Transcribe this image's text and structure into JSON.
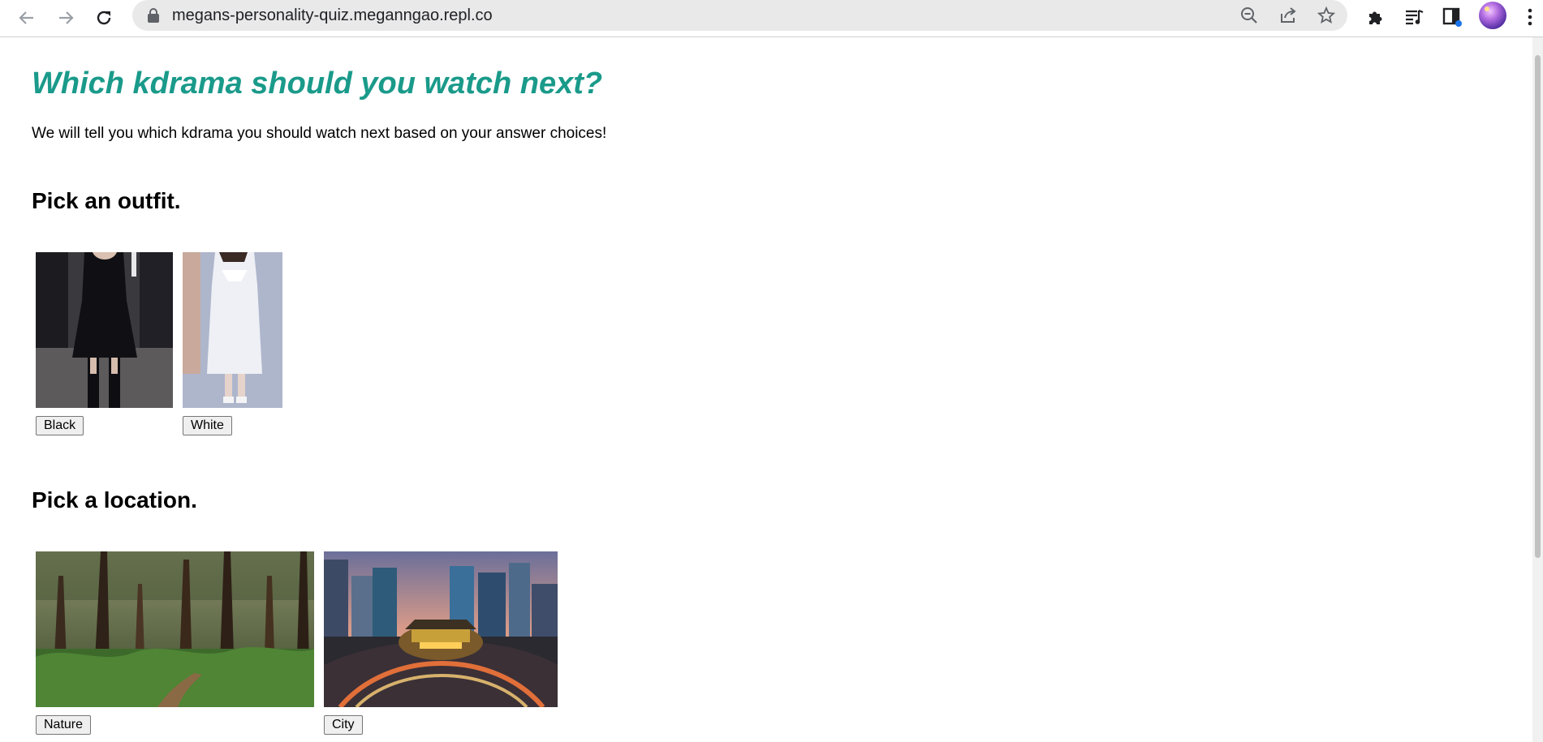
{
  "browser": {
    "url": "megans-personality-quiz.meganngao.repl.co",
    "icons": [
      "back-arrow-icon",
      "forward-arrow-icon",
      "reload-icon",
      "lock-icon",
      "zoom-out-icon",
      "share-icon",
      "star-icon",
      "extensions-puzzle-icon",
      "reading-list-icon",
      "side-panel-icon",
      "profile-avatar",
      "more-menu-icon"
    ]
  },
  "page": {
    "title": "Which kdrama should you watch next?",
    "intro": "We will tell you which kdrama you should watch next based on your answer choices!",
    "title_color": "#1a9a8a",
    "questions": [
      {
        "heading": "Pick an outfit.",
        "choices": [
          {
            "label": "Black",
            "image": "black-outfit-photo"
          },
          {
            "label": "White",
            "image": "white-outfit-photo"
          }
        ]
      },
      {
        "heading": "Pick a location.",
        "choices": [
          {
            "label": "Nature",
            "image": "forest-photo"
          },
          {
            "label": "City",
            "image": "city-night-photo"
          }
        ]
      }
    ]
  }
}
